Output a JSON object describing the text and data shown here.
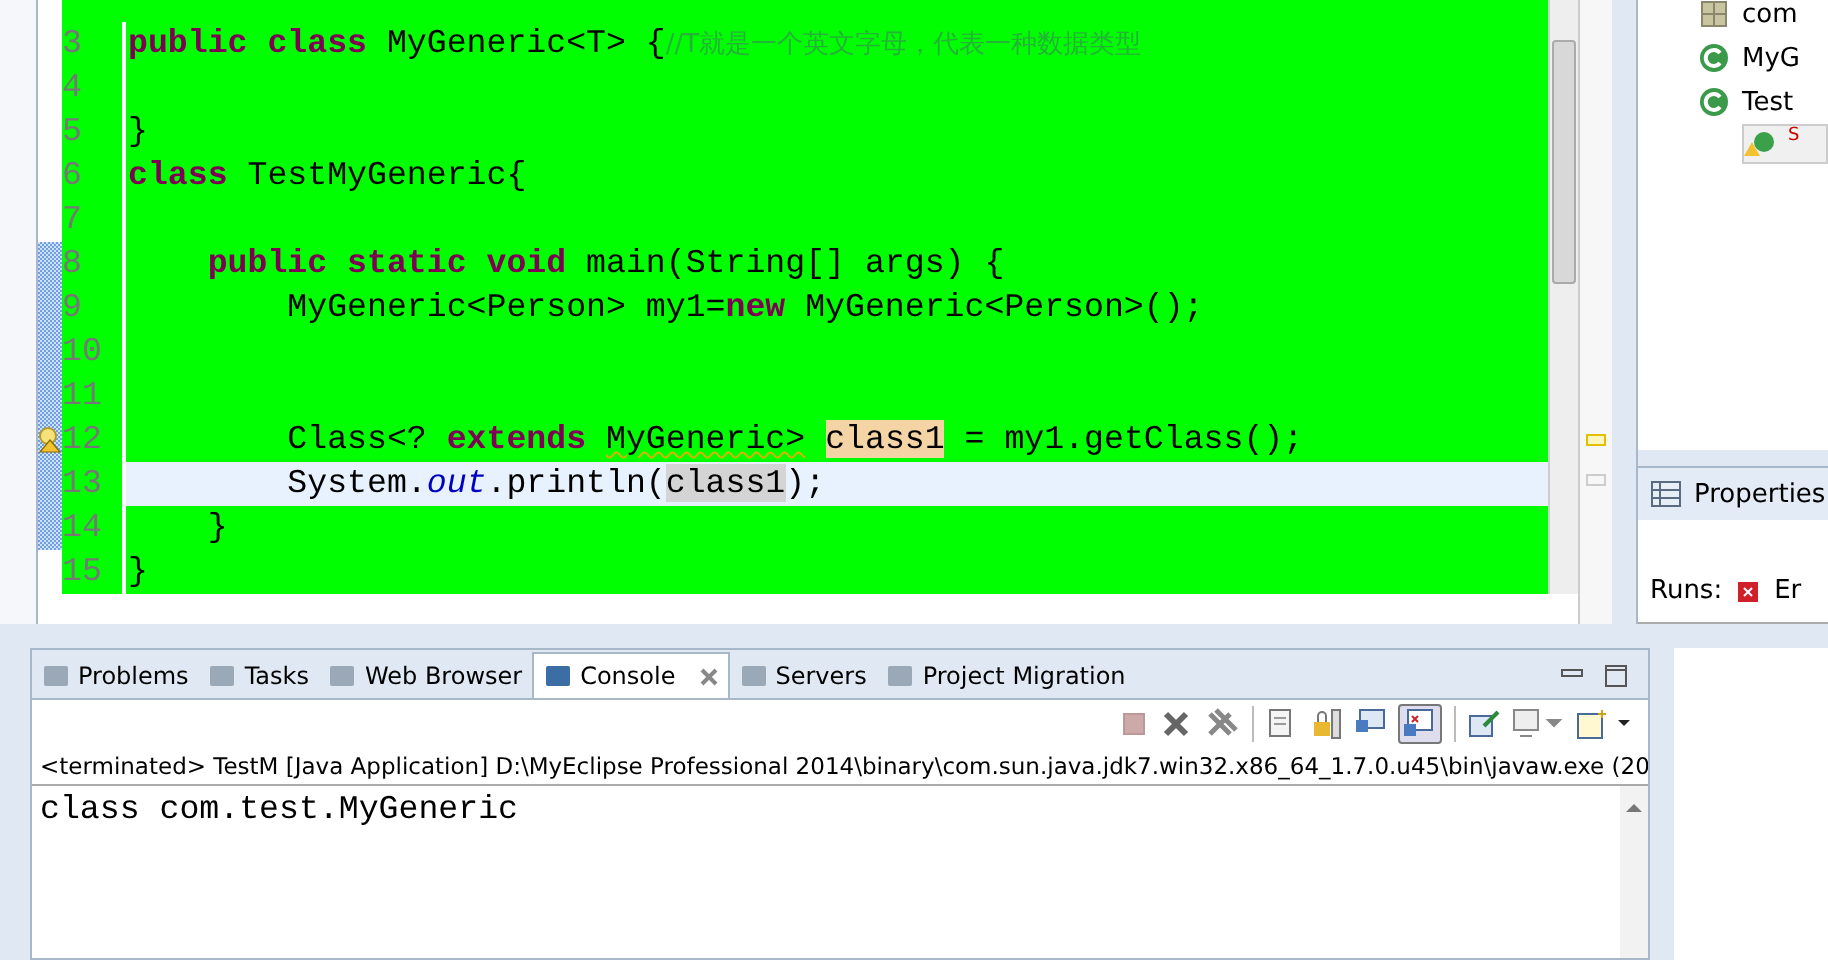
{
  "editor": {
    "lines": [
      {
        "number": "3",
        "selected": false,
        "warning": false,
        "tokens": [
          {
            "text": "public class ",
            "kind": "keyword"
          },
          {
            "text": "MyGeneric<T> {",
            "kind": "plain"
          },
          {
            "text": "//T就是一个英文字母，代表一种数据类型",
            "kind": "comment"
          }
        ]
      },
      {
        "number": "4",
        "selected": false,
        "warning": false
      },
      {
        "number": "5",
        "selected": false,
        "warning": false,
        "tokens": [
          {
            "text": "}",
            "kind": "plain"
          }
        ]
      },
      {
        "number": "6",
        "selected": false,
        "warning": false,
        "tokens": [
          {
            "text": "class ",
            "kind": "keyword"
          },
          {
            "text": "TestMyGeneric{",
            "kind": "plain"
          }
        ]
      },
      {
        "number": "7",
        "selected": false,
        "warning": false
      },
      {
        "number": "8",
        "selected": false,
        "warning": false,
        "tokens": [
          {
            "text": "    public static void ",
            "kind": "keyword"
          },
          {
            "text": "main(String[] args) {",
            "kind": "plain"
          }
        ]
      },
      {
        "number": "9",
        "selected": false,
        "warning": false,
        "tokens": [
          {
            "text": "        MyGeneric<Person> my1=",
            "kind": "plain"
          },
          {
            "text": "new ",
            "kind": "keyword"
          },
          {
            "text": "MyGeneric<Person>();",
            "kind": "plain"
          }
        ]
      },
      {
        "number": "10",
        "selected": false,
        "warning": false
      },
      {
        "number": "11",
        "selected": false,
        "warning": false
      },
      {
        "number": "12",
        "selected": false,
        "warning": true,
        "tokens": [
          {
            "text": "        Class<? ",
            "kind": "plain"
          },
          {
            "text": "extends ",
            "kind": "keyword"
          },
          {
            "text": "MyGeneric>",
            "kind": "warning"
          },
          {
            "text": "class1",
            "kind": "occurrence"
          },
          {
            "text": " = my1.getClass();",
            "kind": "plain"
          }
        ]
      },
      {
        "number": "13",
        "selected": true,
        "warning": false,
        "tokens": [
          {
            "text": "        System.",
            "kind": "plain"
          },
          {
            "text": "out",
            "kind": "field"
          },
          {
            "text": ".println(",
            "kind": "plain"
          },
          {
            "text": "class1",
            "kind": "match"
          },
          {
            "text": ");",
            "kind": "plain"
          }
        ]
      },
      {
        "number": "14",
        "selected": false,
        "warning": false,
        "tokens": [
          {
            "text": "    }",
            "kind": "plain"
          }
        ]
      },
      {
        "number": "15",
        "selected": false,
        "warning": false,
        "tokens": [
          {
            "text": "}",
            "kind": "plain"
          }
        ]
      }
    ]
  },
  "outline": {
    "items": [
      {
        "label": "com",
        "kind": "package"
      },
      {
        "label": "MyG",
        "kind": "class"
      },
      {
        "label": "Test",
        "kind": "class-warning"
      },
      {
        "label": "S",
        "kind": "method"
      }
    ]
  },
  "bottom_panel": {
    "tabs": [
      {
        "label": "Problems",
        "selected": false
      },
      {
        "label": "Tasks",
        "selected": false
      },
      {
        "label": "Web Browser",
        "selected": false
      },
      {
        "label": "Console",
        "selected": true
      },
      {
        "label": "Servers",
        "selected": false
      },
      {
        "label": "Project Migration",
        "selected": false
      }
    ],
    "console_header": "<terminated> TestM [Java Application] D:\\MyEclipse Professional 2014\\binary\\com.sun.java.jdk7.win32.x86_64_1.7.0.u45\\bin\\javaw.exe (20",
    "output": "class com.test.MyGeneric"
  },
  "properties_panel": {
    "title": "Properties",
    "runs_label": "Runs:",
    "runs_value": "Er"
  }
}
